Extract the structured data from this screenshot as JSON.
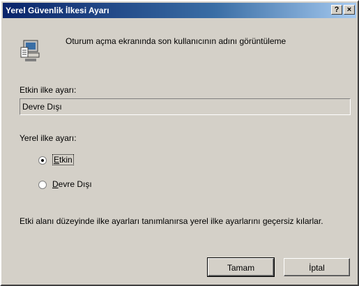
{
  "window": {
    "title": "Yerel Güvenlik İlkesi Ayarı",
    "help_label": "?",
    "close_label": "×"
  },
  "policy": {
    "title": "Oturum açma ekranında son kullanıcının adını görüntüleme",
    "icon": "computer-policy-icon"
  },
  "effective": {
    "label": "Etkin ilke ayarı:",
    "value": "Devre Dışı"
  },
  "local": {
    "label": "Yerel ilke ayarı:",
    "options": [
      {
        "label": "Etkin",
        "checked": true
      },
      {
        "label": "Devre Dışı",
        "checked": false
      }
    ]
  },
  "note": "Etki alanı düzeyinde ilke ayarları tanımlanırsa yerel ilke ayarlarını geçersiz kılarlar.",
  "buttons": {
    "ok": "Tamam",
    "cancel": "İptal"
  },
  "colors": {
    "titlebar_start": "#0a246a",
    "titlebar_end": "#a6caf0",
    "face": "#d4d0c8"
  }
}
